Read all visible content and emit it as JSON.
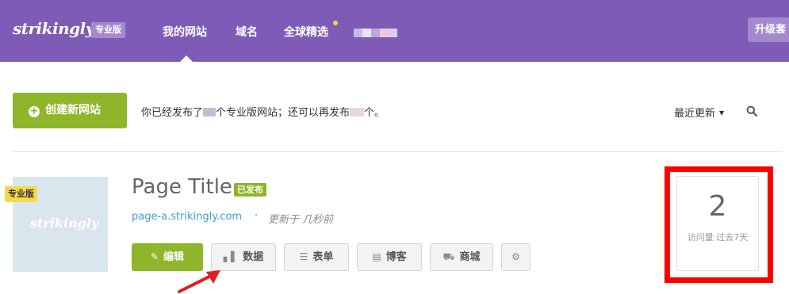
{
  "header": {
    "logo": "strikingly",
    "plan_badge": "专业版",
    "nav": [
      "我的网站",
      "域名",
      "全球精选"
    ],
    "upgrade_label": "升级套"
  },
  "toolbar": {
    "create_label": "创建新网站",
    "publish_info_prefix": "你已经发布了",
    "publish_info_middle": "个专业版网站；还可以再发布",
    "publish_info_suffix": "个。",
    "sort_label": "最近更新"
  },
  "site": {
    "thumb_logo": "strikingly",
    "thumb_badge": "专业版",
    "title": "Page Title",
    "status": "已发布",
    "url": "page-a.strikingly.com",
    "separator": "·",
    "updated": "更新于 几秒前",
    "actions": [
      {
        "label": "编辑",
        "icon": "pencil-icon"
      },
      {
        "label": "数据",
        "icon": "bar-chart-icon"
      },
      {
        "label": "表单",
        "icon": "list-icon"
      },
      {
        "label": "博客",
        "icon": "book-icon"
      },
      {
        "label": "商城",
        "icon": "cart-icon"
      },
      {
        "label": "",
        "icon": "gear-icon"
      }
    ]
  },
  "stats": {
    "value": "2",
    "label": "访问量 过去7天"
  },
  "colors": {
    "header_bg": "#7f5bb8",
    "accent_green": "#8fb52a",
    "highlight_red": "#ff0000",
    "link_blue": "#3d9fcf"
  }
}
